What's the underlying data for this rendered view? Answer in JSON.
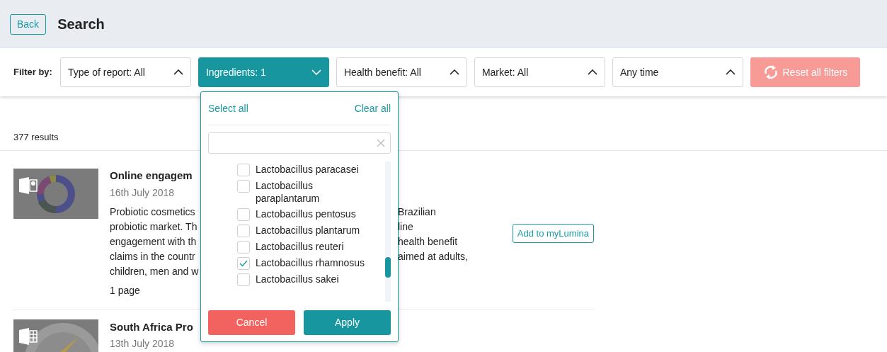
{
  "header": {
    "back": "Back",
    "title": "Search"
  },
  "filter_bar": {
    "label": "Filter by:",
    "filters": [
      {
        "label": "Type of report: All",
        "selected": false
      },
      {
        "label": "Ingredients: 1",
        "selected": true
      },
      {
        "label": "Health benefit: All",
        "selected": false
      },
      {
        "label": "Market: All",
        "selected": false
      },
      {
        "label": "Any time",
        "selected": false
      }
    ],
    "reset": {
      "label": "Reset all filters",
      "disabled": true
    }
  },
  "results_count": "377 results",
  "results": [
    {
      "kind": "slides",
      "title": "Online engagem",
      "date": "16th July 2018",
      "lines": [
        {
          "left": "Probiotic cosmetics",
          "right": "Brazilian"
        },
        {
          "left": "probiotic market. Th",
          "right": "line"
        },
        {
          "left": "engagement with th",
          "right": "health benefit"
        },
        {
          "left": "claims in the countr",
          "right": "aimed at adults,"
        },
        {
          "left": "children, men and w"
        }
      ],
      "pages": "1 page",
      "action": "Add to myLumina"
    },
    {
      "kind": "spreadsheet",
      "title": "South Africa Pro",
      "date": "13th July 2018"
    }
  ],
  "dropdown": {
    "select_all": "Select all",
    "clear_all": "Clear all",
    "options": [
      {
        "label": "Lactobacillus paracasei",
        "checked": false
      },
      {
        "label": "Lactobacillus paraplantarum",
        "checked": false
      },
      {
        "label": "Lactobacillus pentosus",
        "checked": false
      },
      {
        "label": "Lactobacillus plantarum",
        "checked": false
      },
      {
        "label": "Lactobacillus reuteri",
        "checked": false
      },
      {
        "label": "Lactobacillus rhamnosus",
        "checked": true
      },
      {
        "label": "Lactobacillus sakei",
        "checked": false
      }
    ],
    "cancel": "Cancel",
    "apply": "Apply"
  }
}
